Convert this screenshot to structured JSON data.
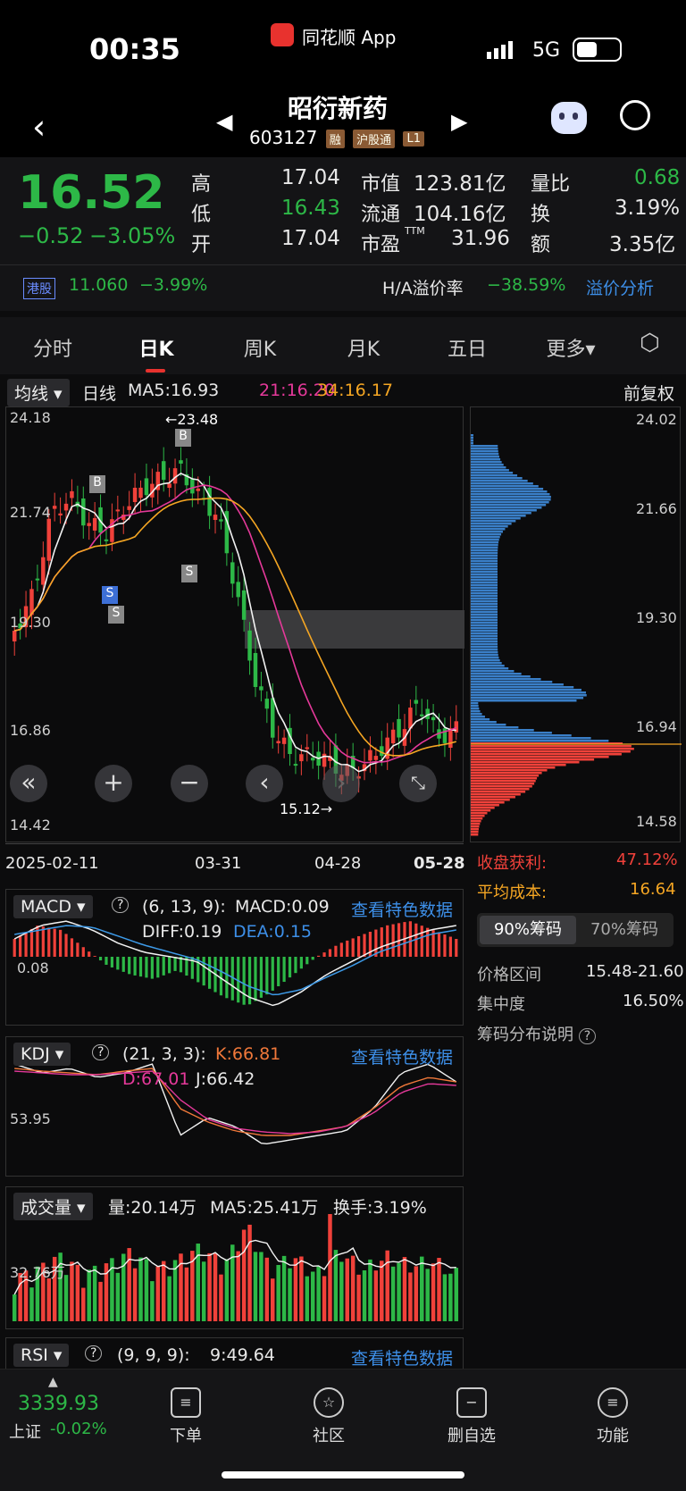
{
  "status": {
    "time": "00:35",
    "app": "同花顺 App",
    "network": "5G"
  },
  "nav": {
    "name": "昭衍新药",
    "code": "603127",
    "tags": [
      "融",
      "沪股通",
      "L1"
    ]
  },
  "quote": {
    "price": "16.52",
    "change": "−0.52",
    "pct": "−3.05%",
    "high_l": "高",
    "high": "17.04",
    "low_l": "低",
    "low": "16.43",
    "open_l": "开",
    "open": "17.04",
    "mcap_l": "市值",
    "mcap": "123.81亿",
    "float_l": "流通",
    "float": "104.16亿",
    "pe_l": "市盈",
    "pe_sup": "TTM",
    "pe": "31.96",
    "vr_l": "量比",
    "vr": "0.68",
    "turn_l": "换",
    "turn": "3.19%",
    "amt_l": "额",
    "amt": "3.35亿",
    "hk_l": "港股",
    "hk": "11.060",
    "hk_pct": "−3.99%",
    "ha_l": "H/A溢价率",
    "ha": "−38.59%",
    "ha_link": "溢价分析"
  },
  "tabs": [
    "分时",
    "日K",
    "周K",
    "月K",
    "五日",
    "更多"
  ],
  "kline": {
    "selector": "均线",
    "period": "日线",
    "ma5": "MA5:16.93",
    "ma21": "21:16.20",
    "ma34": "34:16.17",
    "adjust": "前复权",
    "y_top": "24.18",
    "y_2": "21.74",
    "y_3": "19.30",
    "y_4": "16.86",
    "y_low": "14.42",
    "hi_mark": "←23.48",
    "lo_mark": "15.12→",
    "dates": [
      "2025-02-11",
      "03-31",
      "04-28",
      "05-28"
    ],
    "markers": [
      "B",
      "B",
      "S",
      "S",
      "S"
    ]
  },
  "chips": {
    "y": [
      "24.02",
      "21.66",
      "19.30",
      "16.94",
      "14.58"
    ],
    "profit_l": "收盘获利:",
    "profit": "47.12%",
    "cost_l": "平均成本:",
    "cost": "16.64",
    "tab90": "90%筹码",
    "tab70": "70%筹码",
    "range_l": "价格区间",
    "range": "15.48-21.60",
    "conc_l": "集中度",
    "conc": "16.50%",
    "explain": "筹码分布说明"
  },
  "macd": {
    "name": "MACD",
    "params": "(6, 13, 9):",
    "macd": "MACD:0.09",
    "diff": "DIFF:0.19",
    "dea": "DEA:0.15",
    "axis": "0.08",
    "link": "查看特色数据"
  },
  "kdj": {
    "name": "KDJ",
    "params": "(21, 3, 3):",
    "k": "K:66.81",
    "d": "D:67.01",
    "j": "J:66.42",
    "axis": "53.95",
    "link": "查看特色数据"
  },
  "vol": {
    "name": "成交量",
    "v": "量:20.14万",
    "ma5": "MA5:25.41万",
    "turn": "换手:3.19%",
    "axis": "32.76万"
  },
  "rsi": {
    "name": "RSI",
    "params": "(9, 9, 9):",
    "val": "9:49.64",
    "link": "查看特色数据"
  },
  "bottom": {
    "index_val": "3339.93",
    "index_name": "上证",
    "index_pct": "-0.02%",
    "items": [
      "下单",
      "社区",
      "删自选",
      "功能"
    ]
  }
}
